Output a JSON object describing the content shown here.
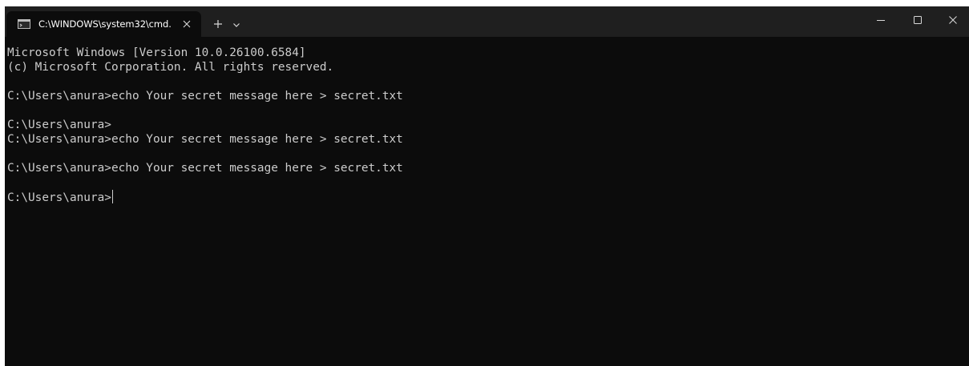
{
  "tab": {
    "title": "C:\\WINDOWS\\system32\\cmd.",
    "icon": "cmd-icon"
  },
  "controls": {
    "new_tab_label": "+",
    "dropdown_icon": "chevron-down-icon",
    "minimize_icon": "minimize-icon",
    "maximize_icon": "maximize-icon",
    "close_icon": "close-icon"
  },
  "terminal": {
    "lines": [
      "Microsoft Windows [Version 10.0.26100.6584]",
      "(c) Microsoft Corporation. All rights reserved.",
      "",
      "C:\\Users\\anura>echo Your secret message here > secret.txt",
      "",
      "C:\\Users\\anura>",
      "C:\\Users\\anura>echo Your secret message here > secret.txt",
      "",
      "C:\\Users\\anura>echo Your secret message here > secret.txt",
      ""
    ],
    "prompt": "C:\\Users\\anura>"
  },
  "colors": {
    "background": "#0c0c0c",
    "titlebar": "#1f1f1f",
    "text": "#cccccc"
  }
}
